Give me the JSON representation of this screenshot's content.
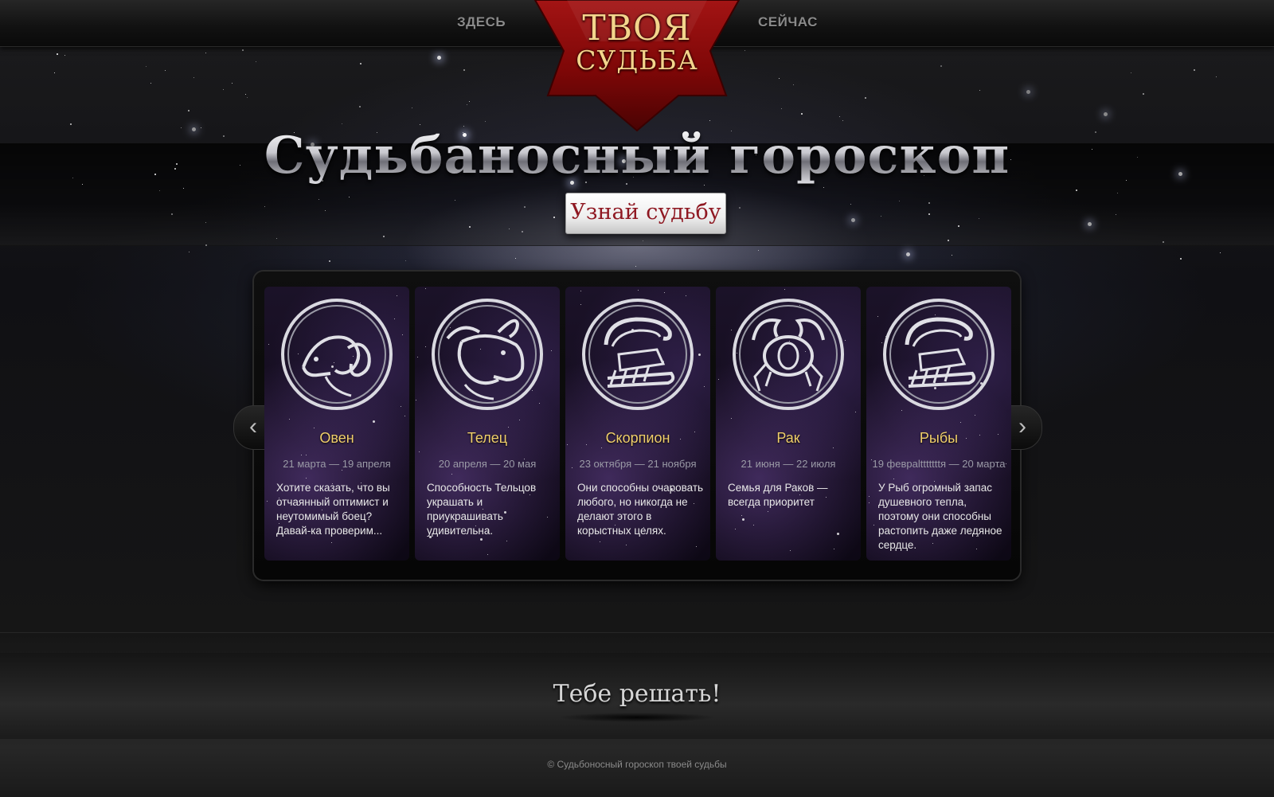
{
  "nav": {
    "left_label": "ЗДЕСЬ",
    "right_label": "СЕЙЧАС"
  },
  "logo": {
    "line1": "ТВОЯ",
    "line2": "СУДЬБА",
    "colors": {
      "star": "#8b0a0a",
      "text": "#f3d58c"
    }
  },
  "hero": {
    "title": "Судьбаносный гороскоп",
    "cta_label": "Узнай судьбу"
  },
  "carousel": {
    "prev_icon": "chevron-left-icon",
    "next_icon": "chevron-right-icon",
    "cards": [
      {
        "icon": "aries-icon",
        "name": "Овен",
        "dates": "21 марта — 19 апреля",
        "text": "Хотите сказать, что вы отчаянный оптимист и неутомимый боец? Давай-ка проверим..."
      },
      {
        "icon": "taurus-icon",
        "name": "Телец",
        "dates": "20 апреля — 20 мая",
        "text": "Способность Тельцов украшать и приукрашивать удивительна."
      },
      {
        "icon": "scorpio-icon",
        "name": "Скорпион",
        "dates": "23 октября — 21 ноября",
        "text": "Они способны очаровать любого, но никогда не делают этого в корыстных целях."
      },
      {
        "icon": "cancer-icon",
        "name": "Рак",
        "dates": "21 июня — 22 июля",
        "text": "Семья для Раков — всегда приоритет"
      },
      {
        "icon": "scorpio-icon",
        "name": "Рыбы",
        "dates": "19 февраltttttttя — 20 марта",
        "text": "У Рыб огромный запас душевного тепла, поэтому они способны растопить даже ледяное сердце."
      }
    ]
  },
  "footer": {
    "slogan": "Тебе решать!",
    "copyright": "©  Судьбоносный гороскоп твоей судьбы"
  },
  "colors": {
    "accent_gold": "#f0cf6a",
    "cta_text": "#8f1822",
    "background": "#161616"
  }
}
